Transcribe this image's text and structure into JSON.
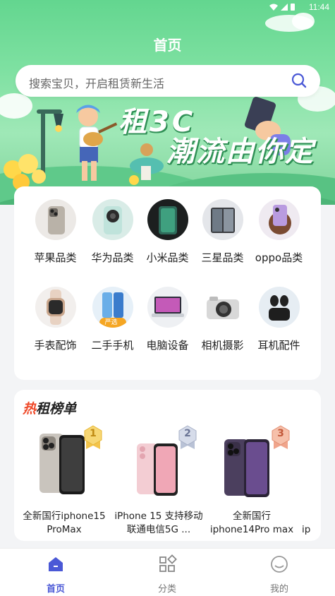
{
  "status_bar": {
    "time": "11:44"
  },
  "header": {
    "title": "首页",
    "search_placeholder": "搜索宝贝，开启租赁新生活"
  },
  "banner": {
    "line1": "租3C",
    "line2": "潮流由你定"
  },
  "categories": [
    {
      "label": "苹果品类",
      "icon": "iphone-icon"
    },
    {
      "label": "华为品类",
      "icon": "huawei-phone-icon"
    },
    {
      "label": "小米品类",
      "icon": "xiaomi-phone-icon"
    },
    {
      "label": "三星品类",
      "icon": "samsung-fold-icon"
    },
    {
      "label": "oppo品类",
      "icon": "oppo-flip-icon"
    },
    {
      "label": "手表配饰",
      "icon": "watch-icon"
    },
    {
      "label": "二手手机",
      "icon": "used-phone-icon",
      "badge": "严选"
    },
    {
      "label": "电脑设备",
      "icon": "laptop-icon"
    },
    {
      "label": "相机摄影",
      "icon": "camera-icon"
    },
    {
      "label": "耳机配件",
      "icon": "earbuds-icon"
    }
  ],
  "hot_list": {
    "title_hot": "热",
    "title_rest": "租榜单",
    "items": [
      {
        "rank": "1",
        "name": "全新国行iphone15 ProMax"
      },
      {
        "rank": "2",
        "name": "iPhone 15 支持移动联通电信5G ..."
      },
      {
        "rank": "3",
        "name": "全新国行 iphone14Pro max"
      },
      {
        "name": "ip"
      }
    ]
  },
  "tabbar": [
    {
      "label": "首页",
      "icon": "home-icon",
      "active": true
    },
    {
      "label": "分类",
      "icon": "category-grid-icon"
    },
    {
      "label": "我的",
      "icon": "profile-icon"
    }
  ],
  "colors": {
    "accent": "#4a58d6",
    "hero_green": "#6fdc96",
    "hot_red": "#ef4a2a"
  }
}
